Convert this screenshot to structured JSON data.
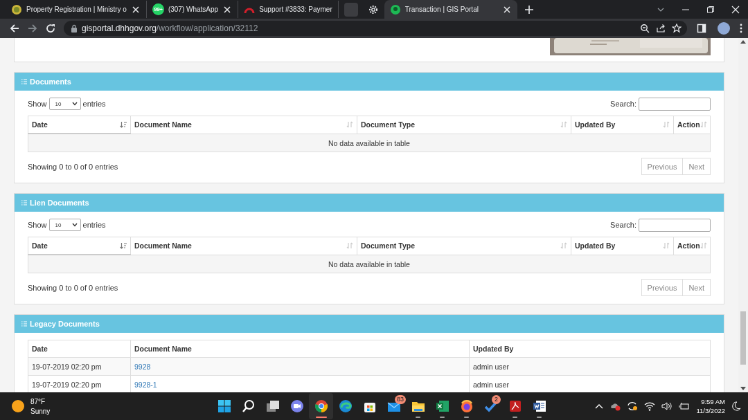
{
  "browser": {
    "tabs": [
      {
        "kind": "page",
        "title": "Property Registration | Ministry o",
        "selected": false,
        "closable": true
      },
      {
        "kind": "page",
        "title": "(307) WhatsApp",
        "badge": "99+",
        "selected": false,
        "closable": true
      },
      {
        "kind": "page",
        "title": "Support #3833: Paymer",
        "selected": false,
        "closable": false
      },
      {
        "kind": "group",
        "selected": false
      },
      {
        "kind": "settings",
        "selected": false
      },
      {
        "kind": "page",
        "title": "Transaction | GIS Portal",
        "selected": true,
        "closable": true
      }
    ],
    "address": {
      "host": "gisportal.dhhgov.org",
      "path": "/workflow/application/32112"
    }
  },
  "page": {
    "panels": [
      {
        "kind": "datatable",
        "title": "Documents",
        "show_label": "Show",
        "length_value": "10",
        "entries_label": "entries",
        "search_label": "Search:",
        "columns": [
          {
            "label": "Date",
            "sorted": true
          },
          {
            "label": "Document Name",
            "sorted": false
          },
          {
            "label": "Document Type",
            "sorted": false
          },
          {
            "label": "Updated By",
            "sorted": false
          },
          {
            "label": "Action",
            "sorted": false
          }
        ],
        "empty_message": "No data available in table",
        "info": "Showing 0 to 0 of 0 entries",
        "pager": [
          {
            "label": "Previous",
            "disabled": true
          },
          {
            "label": "Next",
            "disabled": true
          }
        ]
      },
      {
        "kind": "datatable",
        "title": "Lien Documents",
        "show_label": "Show",
        "length_value": "10",
        "entries_label": "entries",
        "search_label": "Search:",
        "columns": [
          {
            "label": "Date",
            "sorted": true
          },
          {
            "label": "Document Name",
            "sorted": false
          },
          {
            "label": "Document Type",
            "sorted": false
          },
          {
            "label": "Updated By",
            "sorted": false
          },
          {
            "label": "Action",
            "sorted": false
          }
        ],
        "empty_message": "No data available in table",
        "info": "Showing 0 to 0 of 0 entries",
        "pager": [
          {
            "label": "Previous",
            "disabled": true
          },
          {
            "label": "Next",
            "disabled": true
          }
        ]
      },
      {
        "kind": "list",
        "title": "Legacy Documents",
        "columns": [
          "Date",
          "Document Name",
          "Updated By"
        ],
        "rows": [
          {
            "date": "19-07-2019 02:20 pm",
            "name": "9928",
            "updated_by": "admin user"
          },
          {
            "date": "19-07-2019 02:20 pm",
            "name": "9928-1",
            "updated_by": "admin user"
          }
        ]
      }
    ]
  },
  "taskbar": {
    "weather": {
      "temp": "87°F",
      "condition": "Sunny"
    },
    "apps": [
      {
        "kind": "windows",
        "running": false,
        "active": false
      },
      {
        "kind": "search",
        "running": false,
        "active": false
      },
      {
        "kind": "taskview",
        "running": false,
        "active": false
      },
      {
        "kind": "meet",
        "running": false,
        "active": false
      },
      {
        "kind": "chrome",
        "running": true,
        "active": true
      },
      {
        "kind": "edge",
        "running": false,
        "active": false
      },
      {
        "kind": "store",
        "running": false,
        "active": false
      },
      {
        "kind": "mail",
        "badge": "83",
        "running": false,
        "active": false
      },
      {
        "kind": "files",
        "running": true,
        "active": false
      },
      {
        "kind": "excel",
        "running": true,
        "active": false
      },
      {
        "kind": "firefox",
        "running": true,
        "active": false
      },
      {
        "kind": "todo",
        "badge": "2",
        "running": false,
        "active": false
      },
      {
        "kind": "acrobat",
        "running": true,
        "active": false
      },
      {
        "kind": "word",
        "running": true,
        "active": false
      }
    ],
    "clock": {
      "time": "9:59 AM",
      "date": "11/3/2022"
    }
  }
}
